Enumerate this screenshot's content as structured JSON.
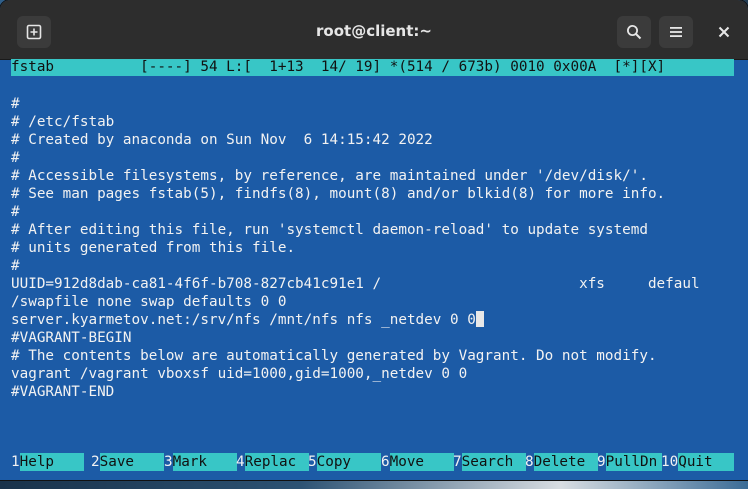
{
  "window": {
    "title": "root@client:~"
  },
  "icons": {
    "new_tab": "new-tab-icon",
    "search": "search-icon",
    "menu": "hamburger-menu-icon",
    "close": "close-icon"
  },
  "editor": {
    "status_line": "fstab          [----] 54 L:[  1+13  14/ 19] *(514 / 673b) 0010 0x00A  [*][X]",
    "lines": [
      "",
      "#",
      "# /etc/fstab",
      "# Created by anaconda on Sun Nov  6 14:15:42 2022",
      "#",
      "# Accessible filesystems, by reference, are maintained under '/dev/disk/'.",
      "# See man pages fstab(5), findfs(8), mount(8) and/or blkid(8) for more info.",
      "#",
      "# After editing this file, run 'systemctl daemon-reload' to update systemd",
      "# units generated from this file.",
      "#",
      "UUID=912d8dab-ca81-4f6f-b708-827cb41c91e1 /                       xfs     defaul",
      "/swapfile none swap defaults 0 0",
      "server.kyarmetov.net:/srv/nfs /mnt/nfs nfs _netdev 0 0",
      "#VAGRANT-BEGIN",
      "# The contents below are automatically generated by Vagrant. Do not modify.",
      "vagrant /vagrant vboxsf uid=1000,gid=1000,_netdev 0 0",
      "#VAGRANT-END"
    ]
  },
  "function_keys": [
    {
      "num": "1",
      "label": "Help"
    },
    {
      "num": "2",
      "label": "Save"
    },
    {
      "num": "3",
      "label": "Mark"
    },
    {
      "num": "4",
      "label": "Replac"
    },
    {
      "num": "5",
      "label": "Copy"
    },
    {
      "num": "6",
      "label": "Move"
    },
    {
      "num": "7",
      "label": "Search"
    },
    {
      "num": "8",
      "label": "Delete"
    },
    {
      "num": "9",
      "label": "PullDn"
    },
    {
      "num": "10",
      "label": "Quit"
    }
  ]
}
